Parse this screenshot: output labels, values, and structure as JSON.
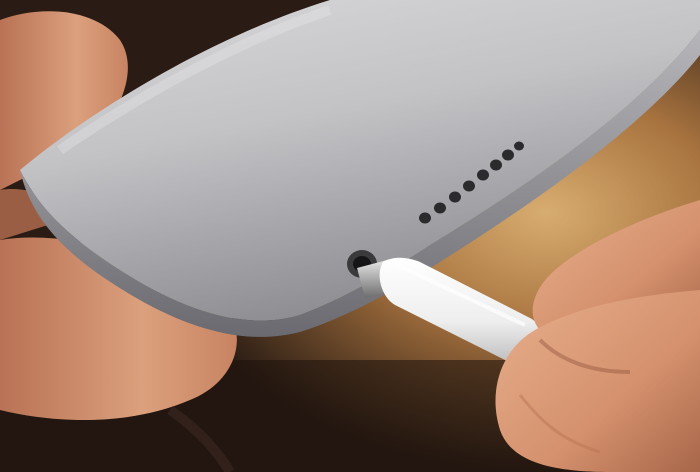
{
  "image": {
    "subject": "photo-scene",
    "colors": {
      "background_dark": "#2a1c14",
      "background_warm": "#c79a5e",
      "device_silver": "#c9c9cb",
      "device_shadow": "#6e6e72",
      "skin": "#d79a78",
      "skin_shadow": "#9a5e44",
      "cable_white": "#f2f2f2",
      "plug_metal": "#b8b8b8",
      "speaker_hole": "#2b2b2e"
    },
    "speaker_holes": 8
  }
}
